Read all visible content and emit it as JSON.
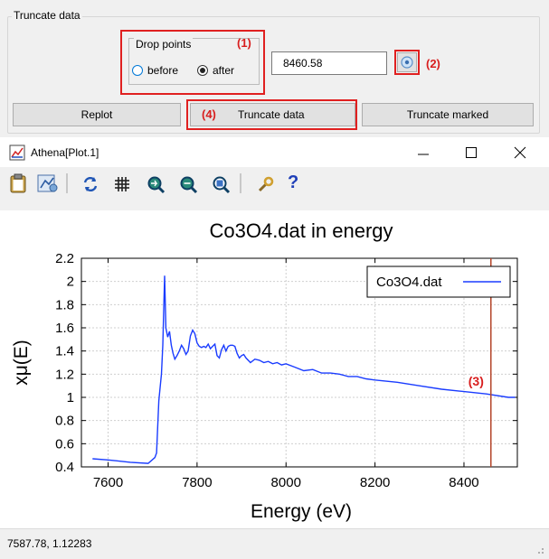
{
  "truncate_panel": {
    "group_title": "Truncate data",
    "drop_points_title": "Drop points",
    "radio_before_label": "before",
    "radio_after_label": "after",
    "selected": "after",
    "value_input": "8460.58",
    "replot_label": "Replot",
    "truncate_label": "Truncate data",
    "truncate_marked_label": "Truncate marked",
    "annotations": [
      "(1)",
      "(2)",
      "(3)",
      "(4)"
    ],
    "annotation_color": "#e02020"
  },
  "window": {
    "title": "Athena[Plot.1]",
    "controls": [
      "minimize-icon",
      "maximize-icon",
      "close-icon"
    ]
  },
  "toolbar": {
    "icons": [
      "clipboard-icon",
      "copy-plot-icon",
      "refresh-icon",
      "grid-icon",
      "zoom-icon",
      "zoom-in-icon",
      "zoom-reset-icon",
      "wrench-icon",
      "help-icon"
    ]
  },
  "chart_data": {
    "type": "line",
    "title": "Co3O4.dat in energy",
    "xlabel": "Energy    (eV)",
    "ylabel": "xμ(E)",
    "xlim": [
      7540,
      8520
    ],
    "ylim": [
      0.4,
      2.2
    ],
    "xticks": [
      "7600",
      "7800",
      "8000",
      "8200",
      "8400"
    ],
    "yticks": [
      "0.4",
      "0.6",
      "0.8",
      "1",
      "1.2",
      "1.4",
      "1.6",
      "1.8",
      "2",
      "2.2"
    ],
    "grid": true,
    "legend_position": "top-right",
    "marker_line_x": 8460.58,
    "series": [
      {
        "name": "Co3O4.dat",
        "color": "#1a3cff",
        "x": [
          7565,
          7600,
          7650,
          7690,
          7705,
          7709,
          7711,
          7714,
          7716,
          7720,
          7723,
          7725,
          7727,
          7730,
          7734,
          7738,
          7742,
          7746,
          7750,
          7755,
          7760,
          7765,
          7770,
          7775,
          7780,
          7785,
          7790,
          7795,
          7800,
          7805,
          7810,
          7815,
          7820,
          7825,
          7830,
          7835,
          7840,
          7845,
          7850,
          7855,
          7860,
          7865,
          7870,
          7875,
          7880,
          7885,
          7890,
          7895,
          7900,
          7905,
          7910,
          7920,
          7930,
          7940,
          7950,
          7960,
          7970,
          7980,
          7990,
          8000,
          8020,
          8040,
          8060,
          8080,
          8100,
          8120,
          8140,
          8160,
          8180,
          8200,
          8250,
          8300,
          8350,
          8400,
          8450,
          8500,
          8515
        ],
        "y": [
          0.47,
          0.46,
          0.44,
          0.43,
          0.48,
          0.52,
          0.7,
          0.97,
          1.05,
          1.2,
          1.45,
          1.75,
          2.05,
          1.6,
          1.52,
          1.57,
          1.45,
          1.38,
          1.33,
          1.36,
          1.4,
          1.45,
          1.42,
          1.37,
          1.4,
          1.53,
          1.58,
          1.55,
          1.47,
          1.44,
          1.43,
          1.44,
          1.43,
          1.46,
          1.42,
          1.44,
          1.46,
          1.36,
          1.34,
          1.41,
          1.45,
          1.4,
          1.44,
          1.45,
          1.45,
          1.44,
          1.38,
          1.34,
          1.36,
          1.37,
          1.34,
          1.3,
          1.33,
          1.32,
          1.3,
          1.31,
          1.29,
          1.3,
          1.28,
          1.29,
          1.26,
          1.23,
          1.24,
          1.21,
          1.21,
          1.2,
          1.18,
          1.18,
          1.16,
          1.15,
          1.13,
          1.1,
          1.07,
          1.05,
          1.03,
          1.0,
          1.0
        ]
      }
    ]
  },
  "status": {
    "coordinates": "7587.78,  1.12283"
  }
}
